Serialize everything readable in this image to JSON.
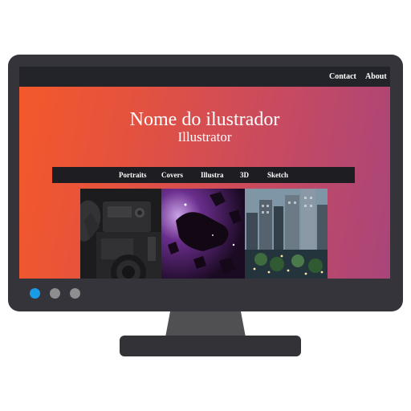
{
  "topnav": {
    "links": [
      "Contact",
      "About"
    ]
  },
  "hero": {
    "title": "Nome do ilustrador",
    "subtitle": "Illustrator"
  },
  "categories": [
    "Portraits",
    "Covers",
    "Illustra",
    "3D",
    "Sketch"
  ],
  "gallery": [
    {
      "subject": "camera-photo"
    },
    {
      "subject": "space-rocks-photo"
    },
    {
      "subject": "city-skyline-photo"
    }
  ],
  "carousel": {
    "slide_count": 3,
    "active_index": 0,
    "colors": {
      "active": "#1a9be6",
      "inactive": "#8e8e90"
    }
  },
  "colors": {
    "gradient_start": "#f4592a",
    "gradient_end": "#a9457a",
    "bar": "#23232a",
    "monitor": "#35343a"
  }
}
